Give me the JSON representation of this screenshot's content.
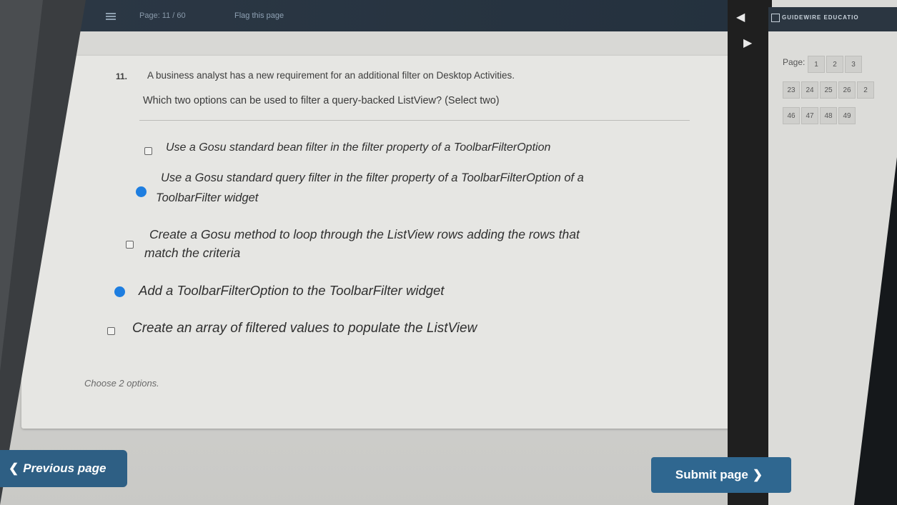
{
  "topbar": {
    "page_label": "Page: 11 / 60",
    "flag_link": "Flag this page"
  },
  "brand": {
    "text": "GUIDEWIRE EDUCATIO"
  },
  "page_nav": {
    "label": "Page:",
    "rows": [
      [
        "1",
        "2",
        "3"
      ],
      [
        "23",
        "24",
        "25",
        "26",
        "2"
      ],
      [
        "46",
        "47",
        "48",
        "49"
      ]
    ]
  },
  "question": {
    "number": "11.",
    "line1": "A business analyst has a new requirement for an additional filter on Desktop Activities.",
    "line2": "Which two options can be used to filter a query-backed ListView? (Select two)"
  },
  "options": [
    {
      "lines": [
        "Use a Gosu standard bean filter in the filter property of a ToolbarFilterOption"
      ],
      "checked": false
    },
    {
      "lines": [
        "Use a Gosu standard query filter in the filter property of a ToolbarFilterOption of a",
        "ToolbarFilter widget"
      ],
      "checked": true
    },
    {
      "lines": [
        "Create a Gosu method to loop through the ListView rows adding the rows that",
        "match the criteria"
      ],
      "checked": false
    },
    {
      "lines": [
        "Add a ToolbarFilterOption to the ToolbarFilter widget"
      ],
      "checked": true
    },
    {
      "lines": [
        "Create an array of filtered values to populate the ListView"
      ],
      "checked": false
    }
  ],
  "hint": "Choose 2 options.",
  "nav": {
    "previous_label": "Previous page",
    "submit_label": "Submit page"
  },
  "colors": {
    "accent": "#1e7ee0",
    "button": "#2f6790",
    "topbar": "#2c3845"
  }
}
